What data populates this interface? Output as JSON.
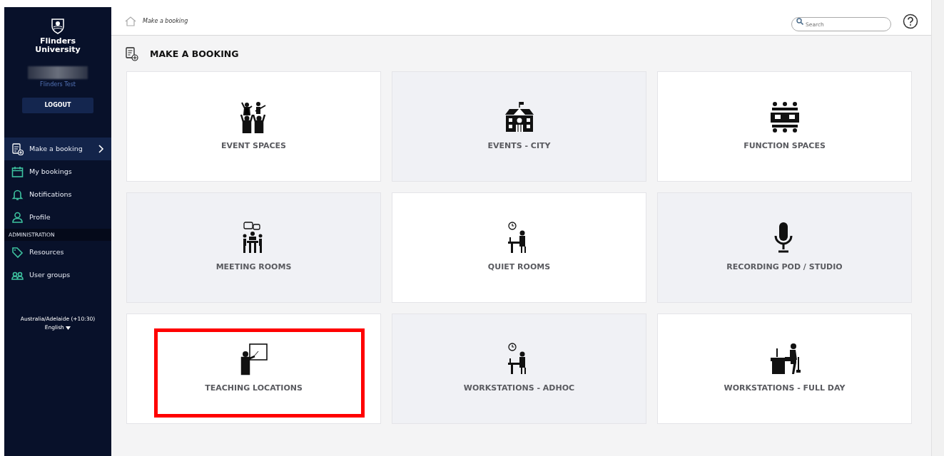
{
  "sidebar": {
    "brand": [
      "Flinders",
      "University"
    ],
    "user_caption": "Flinders Test",
    "logout": "LOGOUT",
    "items": [
      {
        "label": "Make a booking",
        "kind": "booking",
        "selected": true
      },
      {
        "label": "My bookings",
        "kind": "calendar",
        "selected": false
      },
      {
        "label": "Notifications",
        "kind": "bell",
        "selected": false
      },
      {
        "label": "Profile",
        "kind": "person",
        "selected": false
      }
    ],
    "section": "ADMINISTRATION",
    "admin_items": [
      {
        "label": "Resources",
        "kind": "tag",
        "selected": false
      },
      {
        "label": "User groups",
        "kind": "group",
        "selected": false
      }
    ],
    "timezone": "Australia/Adelaide (+10:30)",
    "language": "English"
  },
  "breadcrumb": "Make a booking",
  "search": {
    "placeholder": "Search"
  },
  "page_title": "MAKE A BOOKING",
  "tiles": [
    {
      "label": "EVENT SPACES",
      "kind": "crowd",
      "shaded": false,
      "outlined": false
    },
    {
      "label": "EVENTS - CITY",
      "kind": "building",
      "shaded": true,
      "outlined": false
    },
    {
      "label": "FUNCTION SPACES",
      "kind": "tables",
      "shaded": false,
      "outlined": false
    },
    {
      "label": "MEETING ROOMS",
      "kind": "meeting",
      "shaded": true,
      "outlined": false
    },
    {
      "label": "QUIET ROOMS",
      "kind": "study",
      "shaded": false,
      "outlined": false
    },
    {
      "label": "RECORDING POD / STUDIO",
      "kind": "microphone",
      "shaded": true,
      "outlined": false
    },
    {
      "label": "TEACHING LOCATIONS",
      "kind": "teaching",
      "shaded": false,
      "outlined": true
    },
    {
      "label": "WORKSTATIONS - ADHOC",
      "kind": "study",
      "shaded": true,
      "outlined": false
    },
    {
      "label": "WORKSTATIONS - FULL DAY",
      "kind": "desk",
      "shaded": false,
      "outlined": false
    }
  ]
}
